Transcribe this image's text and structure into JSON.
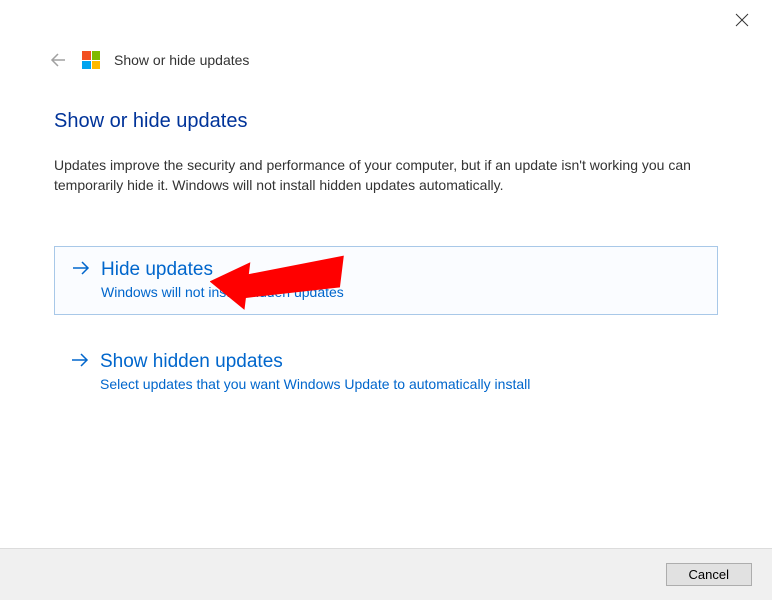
{
  "header": {
    "title": "Show or hide updates"
  },
  "page": {
    "heading": "Show or hide updates",
    "description": "Updates improve the security and performance of your computer, but if an update isn't working you can temporarily hide it. Windows will not install hidden updates automatically."
  },
  "options": [
    {
      "title": "Hide updates",
      "subtitle": "Windows will not install hidden updates"
    },
    {
      "title": "Show hidden updates",
      "subtitle": "Select updates that you want Windows Update to automatically install"
    }
  ],
  "footer": {
    "cancel_label": "Cancel"
  }
}
